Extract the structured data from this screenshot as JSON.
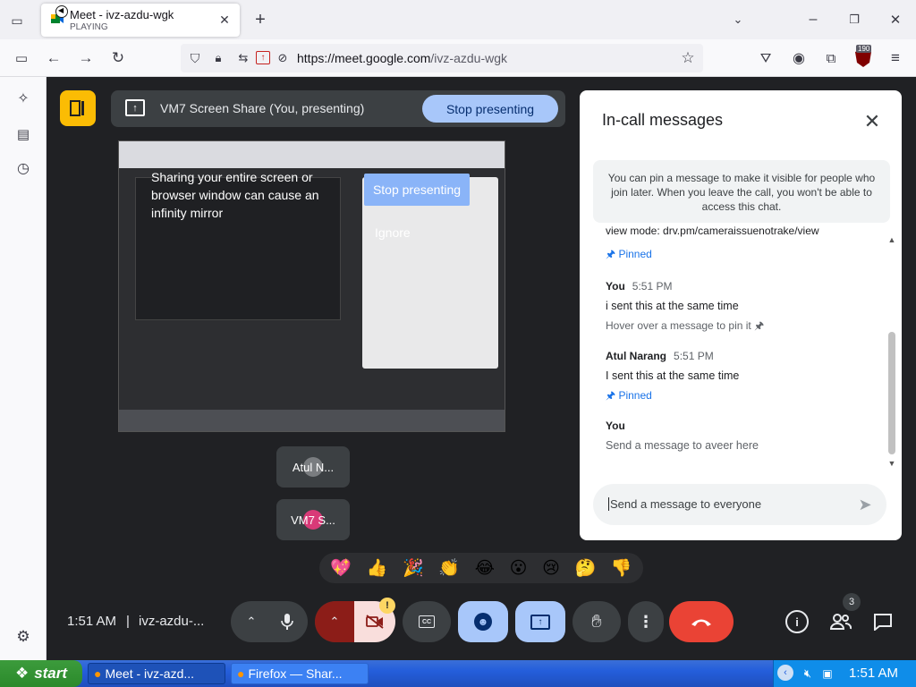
{
  "browser": {
    "tab_title": "Meet - ivz-azdu-wgk",
    "tab_status": "PLAYING",
    "url_host": "https://meet.google.com",
    "url_path": "/ivz-azdu-wgk",
    "ext_badge": "190"
  },
  "presenting": {
    "banner_text": "VM7 Screen Share (You, presenting)",
    "stop_label": "Stop presenting",
    "warning_text": "Sharing your entire screen or browser window can cause an infinity mirror",
    "warning_stop": "Stop presenting",
    "warning_ignore": "Ignore"
  },
  "participants": [
    {
      "label": "Atul N..."
    },
    {
      "label": "VM7 S..."
    }
  ],
  "chat": {
    "title": "In-call messages",
    "info": "You can pin a message to make it visible for people who join later. When you leave the call, you won't be able to access this chat.",
    "truncated_top": "view mode: drv.pm/cameraissuenotrake/view",
    "pinned_label": "Pinned",
    "messages": [
      {
        "sender": "You",
        "time": "5:51 PM",
        "text": "i sent this at the same time",
        "hint": "Hover over a message to pin it"
      },
      {
        "sender": "Atul Narang",
        "time": "5:51 PM",
        "text": "I sent this at the same time",
        "pinned": "Pinned"
      },
      {
        "sender": "You",
        "time": "",
        "text": "Send a message to aveer here"
      }
    ],
    "input_placeholder": "Send a message to everyone"
  },
  "reactions": [
    "💖",
    "👍",
    "🎉",
    "👏",
    "😂",
    "😮",
    "😢",
    "🤔",
    "👎"
  ],
  "controls": {
    "time": "1:51 AM",
    "meeting_code": "ivz-azdu-...",
    "participant_count": "3"
  },
  "taskbar": {
    "start": "start",
    "task1": "Meet - ivz-azd...",
    "task2": "Firefox — Shar...",
    "clock": "1:51 AM"
  },
  "colors": {
    "accent_blue": "#a8c7fa",
    "end_call_red": "#ea4335",
    "mic_red": "#8c1d18"
  }
}
